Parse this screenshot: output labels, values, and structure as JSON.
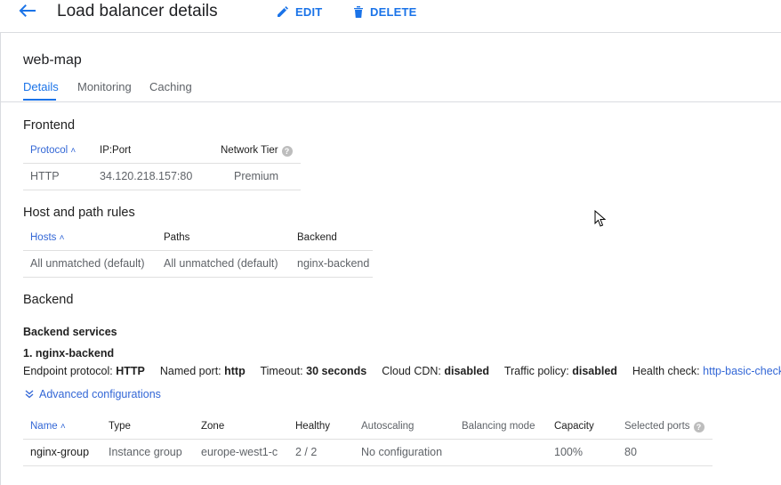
{
  "header": {
    "title": "Load balancer details",
    "edit_label": "EDIT",
    "delete_label": "DELETE"
  },
  "lb_name": "web-map",
  "tabs": [
    {
      "label": "Details",
      "active": true
    },
    {
      "label": "Monitoring",
      "active": false
    },
    {
      "label": "Caching",
      "active": false
    }
  ],
  "frontend": {
    "title": "Frontend",
    "columns": [
      "Protocol",
      "IP:Port",
      "Network Tier"
    ],
    "rows": [
      [
        "HTTP",
        "34.120.218.157:80",
        "Premium"
      ]
    ]
  },
  "host_rules": {
    "title": "Host and path rules",
    "columns": [
      "Hosts",
      "Paths",
      "Backend"
    ],
    "rows": [
      [
        "All unmatched (default)",
        "All unmatched (default)",
        "nginx-backend"
      ]
    ]
  },
  "backend": {
    "title": "Backend",
    "services_title": "Backend services",
    "service_name": "1. nginx-backend",
    "props": {
      "endpoint_protocol_label": "Endpoint protocol:",
      "endpoint_protocol": "HTTP",
      "named_port_label": "Named port:",
      "named_port": "http",
      "timeout_label": "Timeout:",
      "timeout": "30 seconds",
      "cdn_label": "Cloud CDN:",
      "cdn": "disabled",
      "traffic_label": "Traffic policy:",
      "traffic": "disabled",
      "health_label": "Health check:",
      "health": "http-basic-check"
    },
    "advanced_label": "Advanced configurations",
    "columns": [
      "Name",
      "Type",
      "Zone",
      "Healthy",
      "Autoscaling",
      "Balancing mode",
      "Capacity",
      "Selected ports"
    ],
    "rows": [
      [
        "nginx-group",
        "Instance group",
        "europe-west1-c",
        "2 / 2",
        "No configuration",
        "",
        "100%",
        "80"
      ]
    ]
  },
  "colors": {
    "accent": "#1a73e8",
    "link": "#3367d6",
    "text": "#212121",
    "muted": "#5f6368"
  }
}
